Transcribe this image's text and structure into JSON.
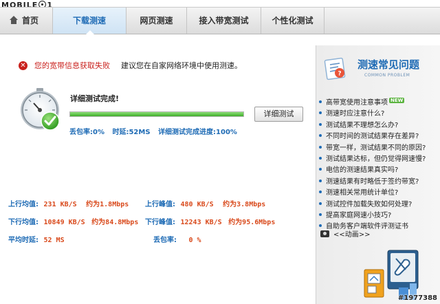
{
  "watermark": {
    "left": "MOBILE",
    "right": "1",
    "id": "#1977388"
  },
  "nav": {
    "tabs": [
      {
        "label": "首页"
      },
      {
        "label": "下载测速"
      },
      {
        "label": "网页测速"
      },
      {
        "label": "接入带宽测试"
      },
      {
        "label": "个性化测试"
      }
    ]
  },
  "main": {
    "error_text": "您的宽带信息获取失败",
    "tip_text": "建议您在自家网络环境中使用测速。",
    "done_title": "详细测试完成!",
    "progress_percent": 100,
    "detail_button": "详细测试",
    "stats": {
      "loss": "丢包率:0%",
      "latency": "时延:52MS",
      "progress": "详细测试完成进度:100%"
    },
    "results": {
      "up_avg_label": "上行均值:",
      "up_avg_value": "231 KB/S",
      "up_avg_approx": "约为1.8Mbps",
      "up_peak_label": "上行峰值:",
      "up_peak_value": "480 KB/S",
      "up_peak_approx": "约为3.8Mbps",
      "down_avg_label": "下行均值:",
      "down_avg_value": "10849 KB/S",
      "down_avg_approx": "约为84.8Mbps",
      "down_peak_label": "下行峰值:",
      "down_peak_value": "12243 KB/S",
      "down_peak_approx": "约为95.6Mbps",
      "latency_label": "平均时延:",
      "latency_value": "52 MS",
      "loss_label": "丢包率:",
      "loss_value": "0 %"
    }
  },
  "sidebar": {
    "title": "测速常见问题",
    "subtitle": "COMMON PROBLEM",
    "new_badge": "NEW",
    "items": [
      "高带宽使用注意事项",
      "测速时应注意什么?",
      "测试结果不理想怎么办?",
      "不同时间的测试结果存在差异?",
      "带宽一样，测试结果不同的原因?",
      "测试结果达标，但仍觉得网速慢?",
      "电信的测速结果真实吗?",
      "测速结果有时略低于签约带宽?",
      "测速相关常用统计单位?",
      "测试控件加载失败如何处理?",
      "提高家庭网速小技巧?",
      "自助务客户端软件评测证书"
    ],
    "anim_label": "<<动画>>"
  },
  "colors": {
    "accent_blue": "#1e6bb5",
    "error_red": "#c9201c",
    "value_orange": "#d94a1c",
    "progress_green": "#3fae2a"
  }
}
